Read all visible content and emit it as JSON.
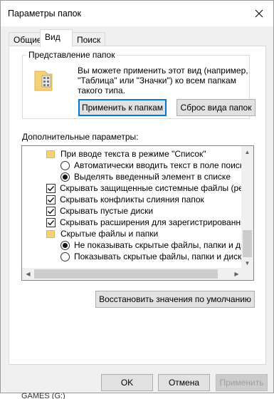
{
  "window": {
    "title": "Параметры папок"
  },
  "tabs": [
    {
      "label": "Общие"
    },
    {
      "label": "Вид"
    },
    {
      "label": "Поиск"
    }
  ],
  "folder_view": {
    "group_label": "Представление папок",
    "description": "Вы можете применить этот вид (например, \"Таблица\" или \"Значки\") ко всем папкам такого типа.",
    "apply_button": "Применить к папкам",
    "reset_button": "Сброс вида папок"
  },
  "advanced": {
    "label": "Дополнительные параметры:",
    "items": [
      {
        "type": "folder",
        "text": "При вводе текста в режиме \"Список\""
      },
      {
        "type": "radio",
        "checked": false,
        "text": "Автоматически вводить текст в поле поиска"
      },
      {
        "type": "radio",
        "checked": true,
        "text": "Выделять введенный элемент в списке"
      },
      {
        "type": "checkbox",
        "checked": true,
        "text": "Скрывать защищенные системные файлы (рекомен"
      },
      {
        "type": "checkbox",
        "checked": true,
        "text": "Скрывать конфликты слияния папок"
      },
      {
        "type": "checkbox",
        "checked": true,
        "text": "Скрывать пустые диски"
      },
      {
        "type": "checkbox",
        "checked": true,
        "text": "Скрывать расширения для зарегистрированных типо"
      },
      {
        "type": "folder",
        "text": "Скрытые файлы и папки"
      },
      {
        "type": "radio",
        "checked": true,
        "text": "Не показывать скрытые файлы, папки и диски"
      },
      {
        "type": "radio",
        "checked": false,
        "text": "Показывать скрытые файлы, папки и диски"
      }
    ],
    "restore_button": "Восстановить значения по умолчанию"
  },
  "footer": {
    "ok_button": "OK",
    "cancel_button": "Отмена",
    "apply_button": "Применить"
  },
  "background": {
    "partial_text": "GAMES (G:)"
  },
  "colors": {
    "accent": "#0078d7",
    "folder": "#f6d277"
  }
}
